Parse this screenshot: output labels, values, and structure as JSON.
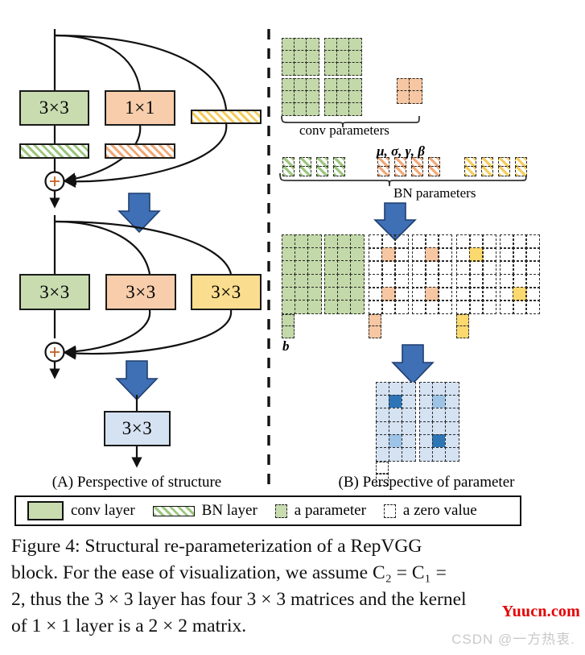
{
  "figure": {
    "panel_a_caption": "(A) Perspective of structure",
    "panel_b_caption": "(B) Perspective of parameter",
    "conv_parameters_label": "conv parameters",
    "bn_parameters_label": "BN parameters",
    "bn_greek_label": "μ,  σ,  γ,  β",
    "bias_label": "b",
    "plus_symbol": "+"
  },
  "structure": {
    "row1": {
      "conv_3x3_label": "3×3",
      "conv_1x1_label": "1×1",
      "identity_label": ""
    },
    "row2": {
      "conv_a_label": "3×3",
      "conv_b_label": "3×3",
      "conv_c_label": "3×3"
    },
    "merged": {
      "conv_label": "3×3"
    }
  },
  "legend": {
    "items": [
      {
        "name": "conv layer",
        "swatch": "filled-green-rect"
      },
      {
        "name": "BN layer",
        "swatch": "hatched-green-bar"
      },
      {
        "name": "a parameter",
        "swatch": "filled-dashed-cell"
      },
      {
        "name": "a zero value",
        "swatch": "empty-dashed-cell"
      }
    ]
  },
  "caption": {
    "lines": [
      "Figure 4:   Structural  re-parameterization  of  a  RepVGG",
      "block. For the ease of visualization, we assume C₂ = C₁ =",
      "2, thus the 3 × 3 layer has four 3 × 3 matrices and the kernel",
      "of 1 × 1 layer is a 2 × 2 matrix."
    ],
    "full_text": "Figure 4: Structural re-parameterization of a RepVGG block. For the ease of visualization, we assume C2 = C1 = 2, thus the 3 × 3 layer has four 3 × 3 matrices and the kernel of 1 × 1 layer is a 2 × 2 matrix."
  },
  "watermarks": {
    "yuucn": "Yuucn.com",
    "csdn": "CSDN @一方热衷."
  },
  "colors": {
    "green_fill": "#c8dcb0",
    "green_param": "#c3d9a9",
    "orange_fill": "#f7cdab",
    "orange_param": "#f6c7a2",
    "yellow_fill": "#fadd8e",
    "yellow_param": "#fbd96f",
    "blue_fill": "#d5e2f2",
    "blue_param_light": "#9dc3e6",
    "blue_param_dark": "#2e75b6",
    "arrow_blue": "#3f6fb5",
    "outline": "#1a1a1a",
    "watermark_red": "#e40000",
    "watermark_grey": "#c9c9c9"
  },
  "chart_data": {
    "type": "diagram",
    "title": "Structural re-parameterization of a RepVGG block",
    "conv_parameters": {
      "group_3x3": {
        "matrix_count": 4,
        "rows": 3,
        "cols": 3,
        "color": "green",
        "filled": "all"
      },
      "group_1x1": {
        "matrix_count": 1,
        "rows": 2,
        "cols": 2,
        "color": "orange",
        "filled": "all"
      }
    },
    "bn_parameters": {
      "groups": [
        {
          "color": "green",
          "count": 4,
          "cells_per_item": 2
        },
        {
          "color": "orange",
          "count": 4,
          "cells_per_item": 2
        },
        {
          "color": "yellow",
          "count": 4,
          "cells_per_item": 2
        }
      ]
    },
    "converted_kernels": {
      "green": {
        "matrices": 4,
        "rows": 3,
        "cols": 3,
        "filled_cells": "all",
        "bias_cells": 2
      },
      "orange": {
        "matrices": 4,
        "rows": 3,
        "cols": 3,
        "filled_cells": [
          [
            1,
            1
          ],
          [
            1,
            1
          ],
          [
            1,
            1
          ],
          [
            1,
            1
          ]
        ],
        "bias_cells": 2
      },
      "yellow": {
        "matrices": 4,
        "rows": 3,
        "cols": 3,
        "filled_cells": [
          [
            1,
            1
          ],
          [],
          [],
          [
            1,
            1
          ]
        ],
        "bias_cells": 2
      }
    },
    "merged_kernel": {
      "matrices": 4,
      "rows": 3,
      "cols": 3,
      "color": "blue",
      "center_values": [
        "dark",
        "light",
        "light",
        "dark"
      ],
      "bias_cells": 2
    }
  }
}
